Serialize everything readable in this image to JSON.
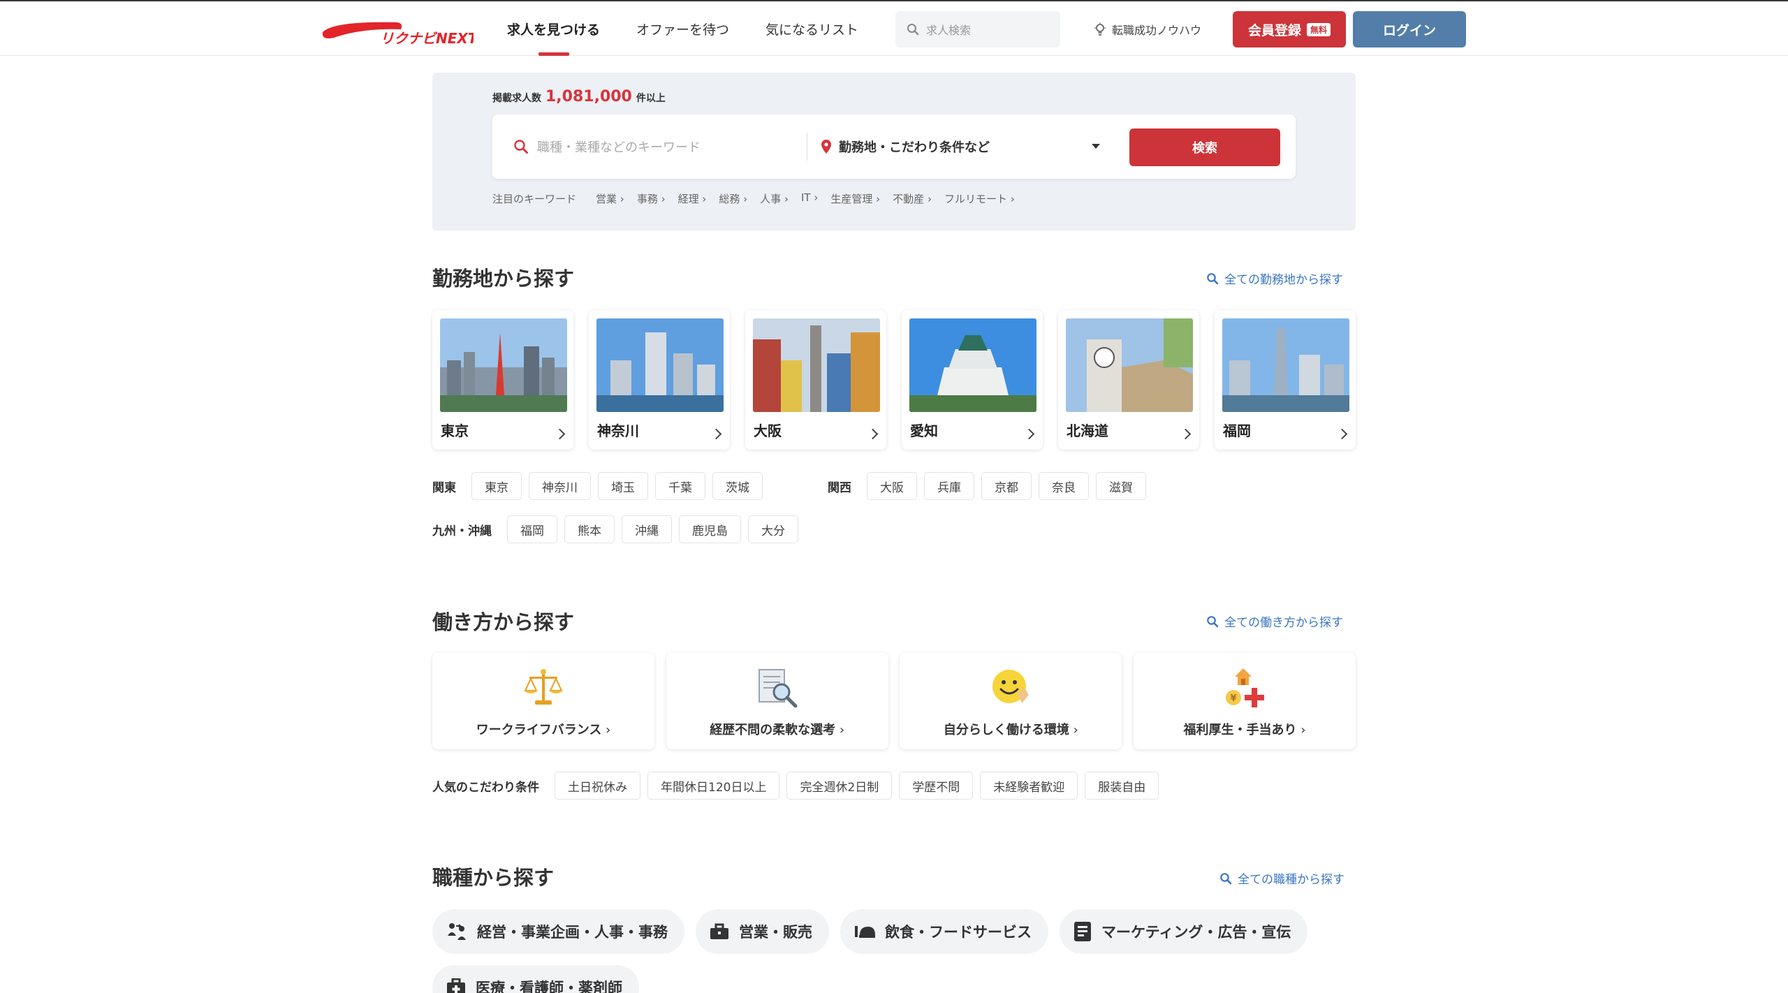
{
  "header": {
    "logo_text": "リクナビNEXT",
    "nav": [
      {
        "label": "求人を見つける",
        "active": true
      },
      {
        "label": "オファーを待つ",
        "active": false
      },
      {
        "label": "気になるリスト",
        "active": false
      }
    ],
    "search_placeholder": "求人検索",
    "knowhow_label": "転職成功ノウハウ",
    "register_label": "会員登録",
    "register_badge": "無料",
    "login_label": "ログイン"
  },
  "hero": {
    "count_prefix": "掲載求人数",
    "count_value": "1,081,000",
    "count_suffix": "件以上",
    "keyword_placeholder": "職種・業種などのキーワード",
    "location_label": "勤務地・こだわり条件など",
    "search_button": "検索",
    "trend_label": "注目のキーワード",
    "trend_keywords": [
      "営業",
      "事務",
      "経理",
      "総務",
      "人事",
      "IT",
      "生産管理",
      "不動産",
      "フルリモート"
    ]
  },
  "area_section": {
    "title": "勤務地から探す",
    "link": "全ての勤務地から探す",
    "cards": [
      {
        "name": "東京"
      },
      {
        "name": "神奈川"
      },
      {
        "name": "大阪"
      },
      {
        "name": "愛知"
      },
      {
        "name": "北海道"
      },
      {
        "name": "福岡"
      }
    ],
    "kanto_label": "関東",
    "kanto": [
      "東京",
      "神奈川",
      "埼玉",
      "千葉",
      "茨城"
    ],
    "kansai_label": "関西",
    "kansai": [
      "大阪",
      "兵庫",
      "京都",
      "奈良",
      "滋賀"
    ],
    "kyushu_label": "九州・沖縄",
    "kyushu": [
      "福岡",
      "熊本",
      "沖縄",
      "鹿児島",
      "大分"
    ]
  },
  "work_section": {
    "title": "働き方から探す",
    "link": "全ての働き方から探す",
    "cards": [
      {
        "label": "ワークライフバランス",
        "icon": "scale-icon"
      },
      {
        "label": "経歴不問の柔軟な選考",
        "icon": "document-search-icon"
      },
      {
        "label": "自分らしく働ける環境",
        "icon": "smile-icon"
      },
      {
        "label": "福利厚生・手当あり",
        "icon": "welfare-icon"
      }
    ],
    "popular_label": "人気のこだわり条件",
    "popular": [
      "土日祝休み",
      "年間休日120日以上",
      "完全週休2日制",
      "学歴不問",
      "未経験者歓迎",
      "服装自由"
    ]
  },
  "job_section": {
    "title": "職種から探す",
    "link": "全ての職種から探す",
    "categories": [
      {
        "label": "経営・事業企画・人事・事務",
        "icon": "people-icon"
      },
      {
        "label": "営業・販売",
        "icon": "briefcase-icon"
      },
      {
        "label": "飲食・フードサービス",
        "icon": "food-service-icon"
      },
      {
        "label": "マーケティング・広告・宣伝",
        "icon": "document-icon"
      },
      {
        "label": "医療・看護師・薬剤師",
        "icon": "medical-bag-icon"
      }
    ]
  }
}
